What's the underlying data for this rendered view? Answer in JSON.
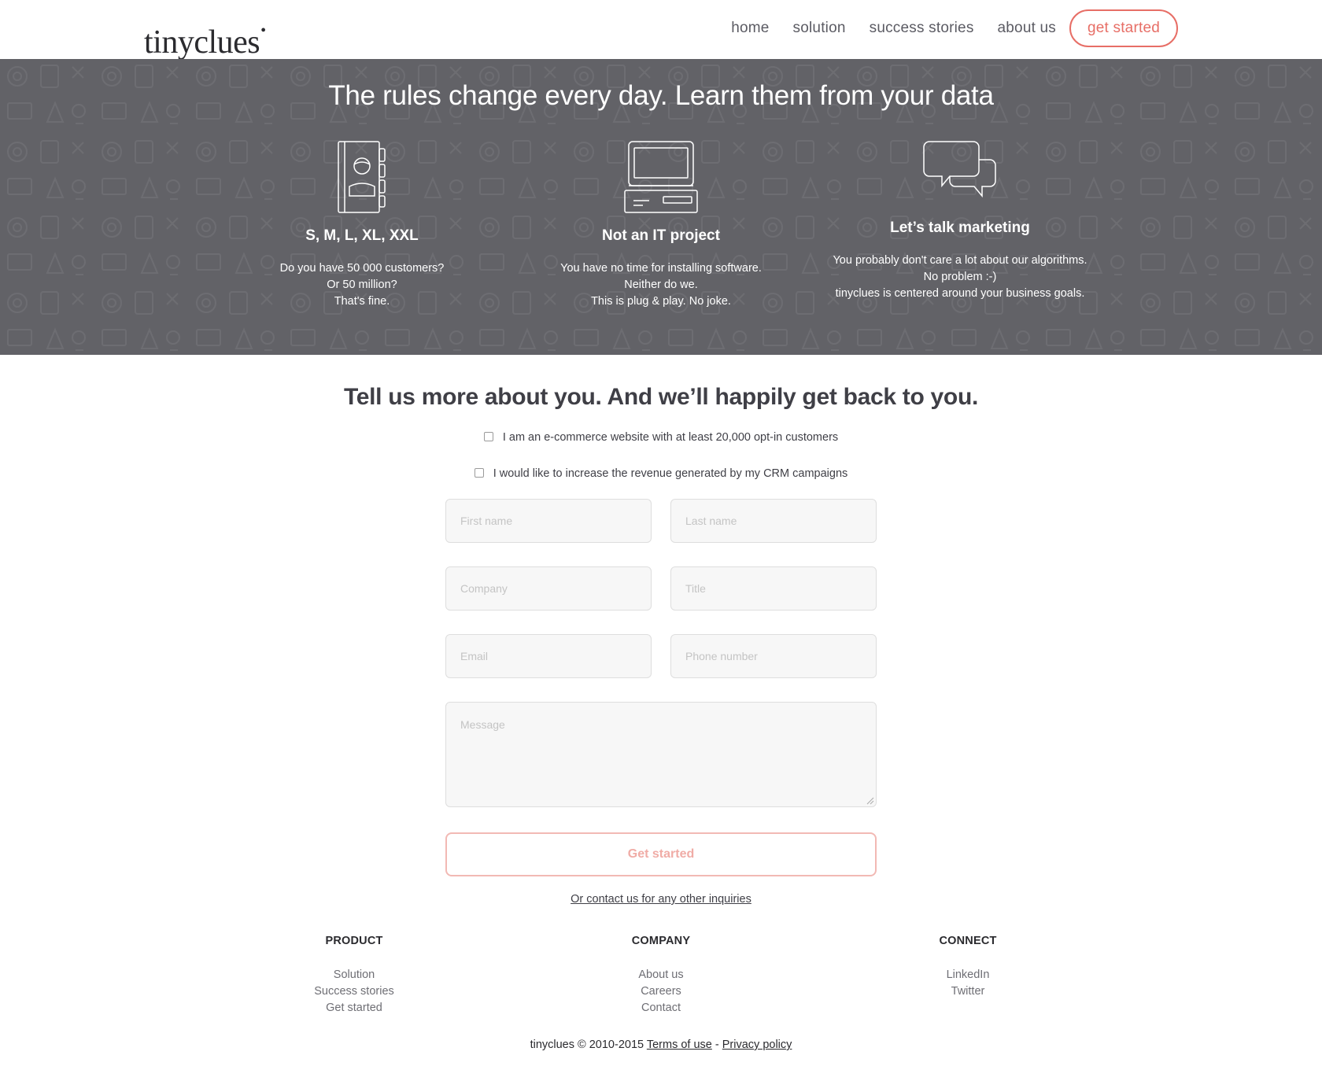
{
  "header": {
    "logo": "tinyclues",
    "nav": [
      {
        "label": "home"
      },
      {
        "label": "solution"
      },
      {
        "label": "success stories"
      },
      {
        "label": "about us"
      }
    ],
    "cta_label": "get started"
  },
  "hero": {
    "title": "The rules change every day. Learn them from your data",
    "features": [
      {
        "icon": "address-book-icon",
        "heading": "S, M, L, XL, XXL",
        "lines": [
          "Do you have 50 000 customers?",
          "Or 50 million?",
          "That's fine."
        ]
      },
      {
        "icon": "computer-icon",
        "heading": "Not an IT project",
        "lines": [
          "You have no time for installing software.",
          "Neither do we.",
          "This is plug & play. No joke."
        ]
      },
      {
        "icon": "speech-bubbles-icon",
        "heading": "Let’s talk marketing",
        "lines": [
          "You probably don't care a lot about our algorithms.",
          "No problem :-)",
          "tinyclues is centered around your business goals."
        ]
      }
    ]
  },
  "form": {
    "title": "Tell us more about you. And we’ll happily get back to you.",
    "checkbox_1": "I am an e-commerce website with at least 20,000 opt-in customers",
    "checkbox_2": "I would like to increase the revenue generated by my CRM campaigns",
    "first_name_placeholder": "First name",
    "last_name_placeholder": "Last name",
    "company_placeholder": "Company",
    "title_placeholder": "Title",
    "email_placeholder": "Email",
    "phone_placeholder": "Phone number",
    "message_placeholder": "Message",
    "submit_label": "Get started",
    "contact_link": "Or contact us for any other inquiries"
  },
  "footer": {
    "product": {
      "heading": "PRODUCT",
      "items": [
        "Solution",
        "Success stories",
        "Get started"
      ]
    },
    "company": {
      "heading": "COMPANY",
      "items": [
        "About us",
        "Careers",
        "Contact"
      ]
    },
    "connect": {
      "heading": "CONNECT",
      "items": [
        "LinkedIn",
        "Twitter"
      ]
    },
    "copyright": "tinyclues © 2010-2015",
    "terms": "Terms of use",
    "separator": "-",
    "privacy": "Privacy policy"
  },
  "colors": {
    "accent": "#e76e66",
    "hero_bg": "#626267",
    "submit_border": "#f2b9b4"
  }
}
